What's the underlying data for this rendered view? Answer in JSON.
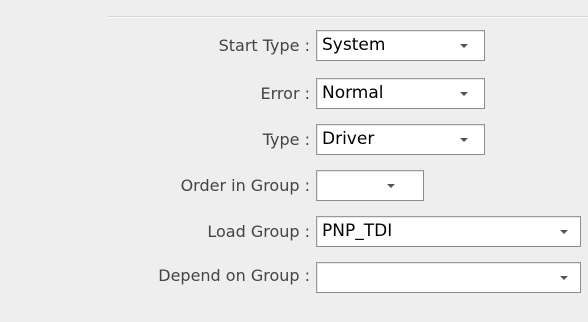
{
  "fields": [
    {
      "label": "Start Type :",
      "value": "System"
    },
    {
      "label": "Error :",
      "value": "Normal"
    },
    {
      "label": "Type :",
      "value": "Driver"
    },
    {
      "label": "Order in Group :",
      "value": ""
    },
    {
      "label": "Load Group :",
      "value": "PNP_TDI"
    },
    {
      "label": "Depend on Group :",
      "value": ""
    }
  ],
  "icons": {
    "dropdown": "chevron-down-icon"
  }
}
